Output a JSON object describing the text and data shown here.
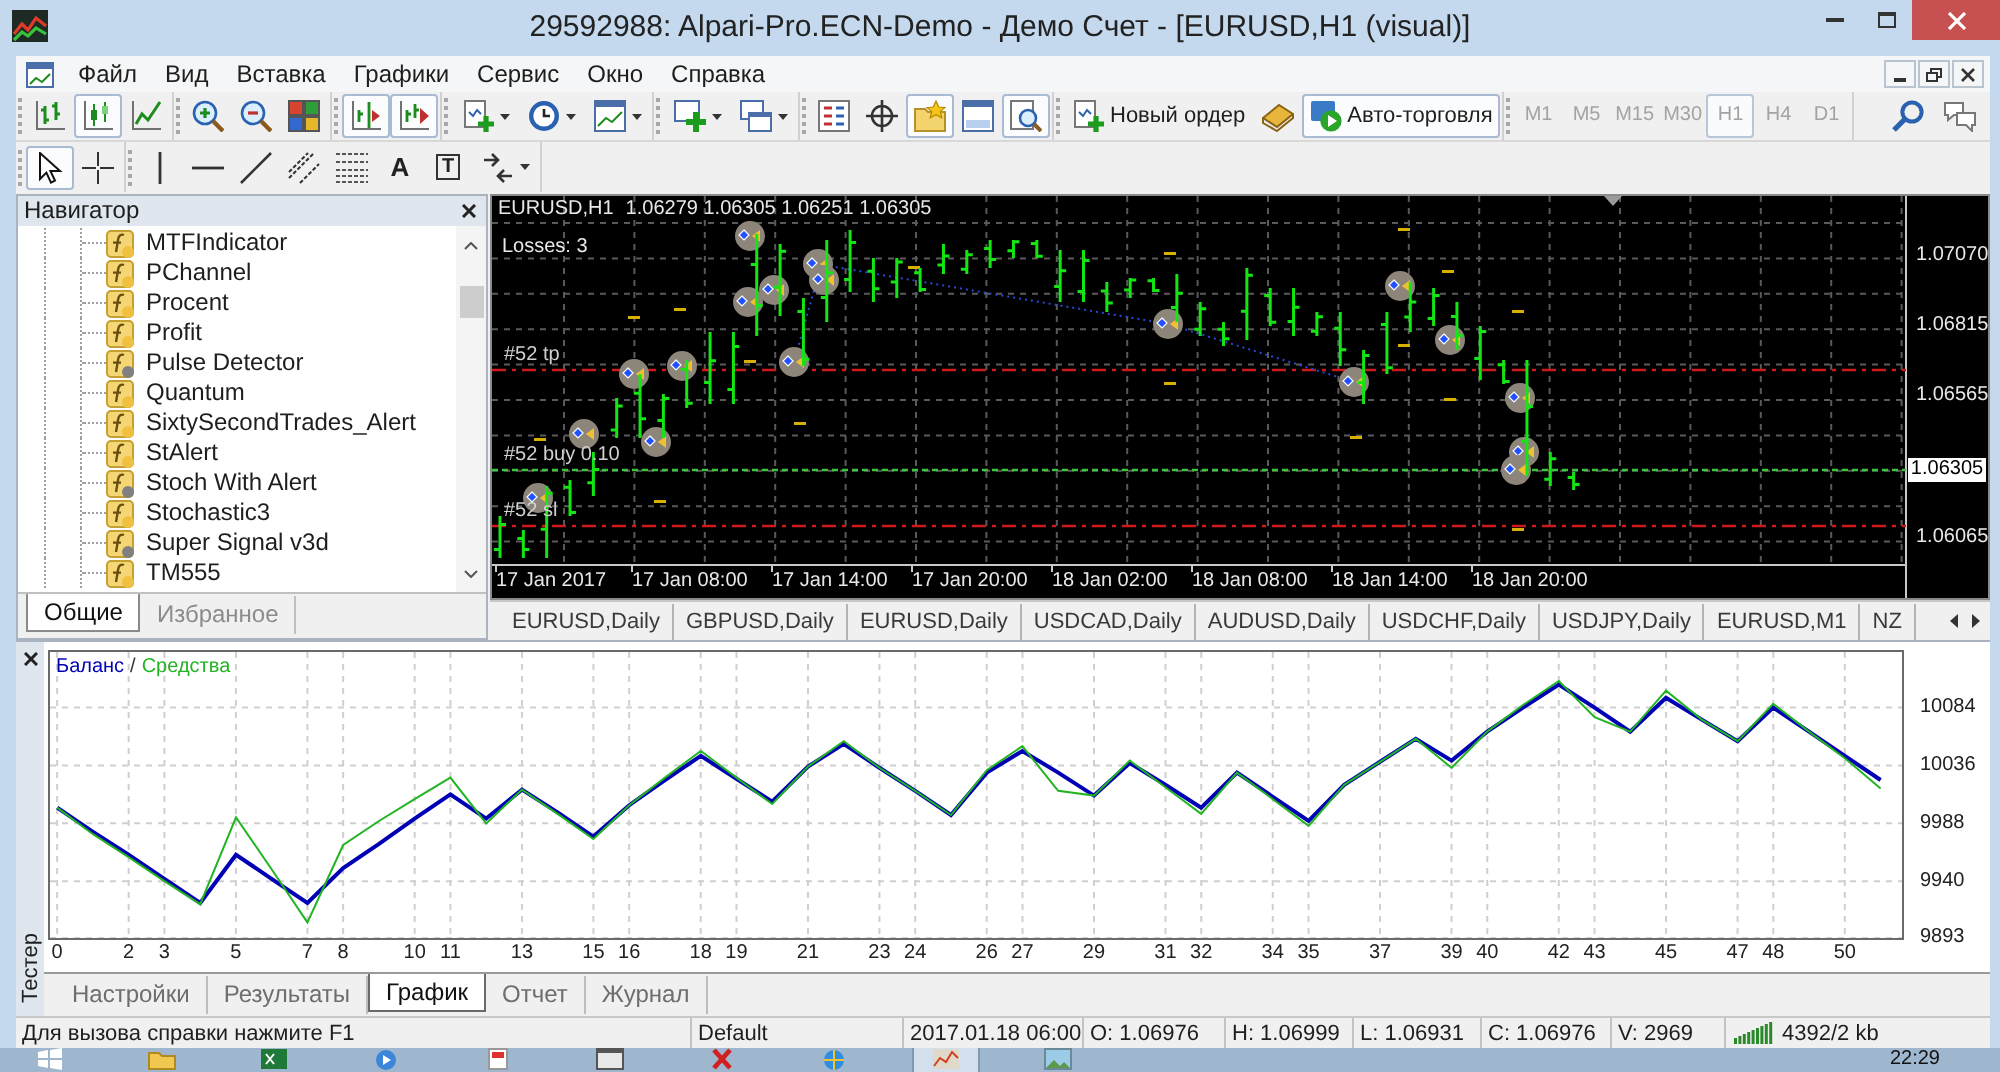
{
  "window": {
    "title": "29592988: Alpari-Pro.ECN-Demo - Демо Счет - [EURUSD,H1 (visual)]"
  },
  "menu": [
    "Файл",
    "Вид",
    "Вставка",
    "Графики",
    "Сервис",
    "Окно",
    "Справка"
  ],
  "toolbar": {
    "groups": [
      [
        {
          "kind": "bars",
          "pressed": false
        },
        {
          "kind": "candles",
          "pressed": true
        },
        {
          "kind": "line",
          "pressed": false
        }
      ],
      [
        {
          "kind": "zoom-in",
          "pressed": false
        },
        {
          "kind": "zoom-out",
          "pressed": false
        },
        {
          "kind": "tile",
          "pressed": false
        }
      ],
      [
        {
          "kind": "shift",
          "pressed": true
        },
        {
          "kind": "autoscroll",
          "pressed": true
        }
      ],
      [
        {
          "kind": "indicators",
          "menu": true
        },
        {
          "kind": "periods",
          "menu": true
        },
        {
          "kind": "templates",
          "menu": true
        }
      ],
      [
        {
          "kind": "new-chart",
          "menu": true
        },
        {
          "kind": "profiles",
          "menu": true
        }
      ],
      [
        {
          "kind": "market-watch",
          "pressed": false
        },
        {
          "kind": "data-window",
          "pressed": false
        },
        {
          "kind": "navigator",
          "pressed": true
        },
        {
          "kind": "terminal",
          "pressed": false
        },
        {
          "kind": "tester",
          "pressed": true
        }
      ],
      [
        {
          "kind": "new-order",
          "label": "Новый ордер",
          "pressed": false
        },
        {
          "kind": "editor",
          "pressed": false
        },
        {
          "kind": "auto-trading",
          "label": "Авто-торговля",
          "pressed": true
        }
      ]
    ],
    "periods": [
      {
        "label": "M1",
        "selected": false,
        "disabled": true
      },
      {
        "label": "M5",
        "selected": false,
        "disabled": true
      },
      {
        "label": "M15",
        "selected": false,
        "disabled": true
      },
      {
        "label": "M30",
        "selected": false,
        "disabled": true
      },
      {
        "label": "H1",
        "selected": true,
        "disabled": true
      },
      {
        "label": "H4",
        "selected": false,
        "disabled": true
      },
      {
        "label": "D1",
        "selected": false,
        "disabled": true
      }
    ],
    "extras": [
      {
        "kind": "search"
      },
      {
        "kind": "chat"
      }
    ]
  },
  "drawing_tools": {
    "groups": [
      [
        {
          "kind": "cursor",
          "pressed": true
        },
        {
          "kind": "crosshair",
          "pressed": false
        }
      ],
      [
        {
          "kind": "vline",
          "pressed": false
        },
        {
          "kind": "hline",
          "pressed": false
        },
        {
          "kind": "trendline",
          "pressed": false
        },
        {
          "kind": "channel",
          "pressed": false
        },
        {
          "kind": "fibo",
          "pressed": false
        },
        {
          "kind": "text",
          "label": "A",
          "pressed": false
        },
        {
          "kind": "text-label",
          "label": "T",
          "pressed": false
        },
        {
          "kind": "arrows",
          "menu": true
        }
      ]
    ]
  },
  "navigator": {
    "title": "Навигатор",
    "items": [
      {
        "label": "MTFIndicator",
        "color": "#f0c040"
      },
      {
        "label": "PChannel",
        "color": "#f0c040"
      },
      {
        "label": "Procent",
        "color": "#f0c040"
      },
      {
        "label": "Profit",
        "color": "#f0c040"
      },
      {
        "label": "Pulse Detector",
        "color": "#808080"
      },
      {
        "label": "Quantum",
        "color": "#f0c040"
      },
      {
        "label": "SixtySecondTrades_Alert",
        "color": "#f0c040"
      },
      {
        "label": "StAlert",
        "color": "#f0c040"
      },
      {
        "label": "Stoch With Alert",
        "color": "#808080"
      },
      {
        "label": "Stochastic3",
        "color": "#f0c040"
      },
      {
        "label": "Super Signal v3d",
        "color": "#808080"
      },
      {
        "label": "TM555",
        "color": "#f0c040"
      }
    ],
    "tabs": [
      {
        "label": "Общие",
        "selected": true
      },
      {
        "label": "Избранное",
        "selected": false
      }
    ]
  },
  "chart": {
    "symbol": "EURUSD,H1",
    "ohlc": "1.06279 1.06305 1.06251 1.06305",
    "info": "Losses: 3",
    "orders": [
      {
        "kind": "tp",
        "label": "#52 tp"
      },
      {
        "kind": "entry",
        "label": "#52 buy 0.10"
      },
      {
        "kind": "sl",
        "label": "#52 sl"
      }
    ],
    "price_ticks": [
      "1.07070",
      "1.06815",
      "1.06565",
      "1.06065"
    ],
    "current_price": "1.06305",
    "time_ticks": [
      "17 Jan 2017",
      "17 Jan 08:00",
      "17 Jan 14:00",
      "17 Jan 20:00",
      "18 Jan 02:00",
      "18 Jan 08:00",
      "18 Jan 14:00",
      "18 Jan 20:00"
    ]
  },
  "chart_tabs": [
    {
      "label": "EURUSD,Daily",
      "selected": false
    },
    {
      "label": "GBPUSD,Daily",
      "selected": false
    },
    {
      "label": "EURUSD,Daily",
      "selected": false
    },
    {
      "label": "USDCAD,Daily",
      "selected": false
    },
    {
      "label": "AUDUSD,Daily",
      "selected": false
    },
    {
      "label": "USDCHF,Daily",
      "selected": false
    },
    {
      "label": "USDJPY,Daily",
      "selected": false
    },
    {
      "label": "EURUSD,M1",
      "selected": false
    },
    {
      "label": "NZ",
      "selected": false
    }
  ],
  "tester": {
    "title": "Тестер",
    "separator": "/",
    "chart_data": {
      "type": "line",
      "grid": true,
      "x": [
        0,
        1,
        2,
        3,
        4,
        5,
        6,
        7,
        8,
        9,
        10,
        11,
        12,
        13,
        14,
        15,
        16,
        17,
        18,
        19,
        20,
        21,
        22,
        23,
        24,
        25,
        26,
        27,
        28,
        29,
        30,
        31,
        32,
        33,
        34,
        35,
        36,
        37,
        38,
        39,
        40,
        41,
        42,
        43,
        44,
        45,
        46,
        47,
        48,
        49,
        50,
        51
      ],
      "series": [
        {
          "name": "Баланс",
          "color": "#0000b4",
          "values": [
            10001,
            9981,
            9962,
            9942,
            9922,
            9962,
            9942,
            9922,
            9951,
            9971,
            9992,
            10012,
            9992,
            10016,
            9997,
            9977,
            10003,
            10024,
            10044,
            10025,
            10006,
            10035,
            10054,
            10034,
            10015,
            9995,
            10030,
            10048,
            10030,
            10011,
            10038,
            10020,
            10001,
            10030,
            10010,
            9990,
            10020,
            10039,
            10058,
            10040,
            10064,
            10084,
            10103,
            10084,
            10064,
            10092,
            10074,
            10056,
            10084,
            10064,
            10044,
            10024
          ]
        },
        {
          "name": "Средства",
          "color": "#22b422",
          "values": [
            10001,
            9979,
            9960,
            9940,
            9921,
            9993,
            9950,
            9906,
            9970,
            9990,
            10008,
            10026,
            9988,
            10016,
            9996,
            9975,
            10003,
            10026,
            10048,
            10026,
            10004,
            10035,
            10056,
            10034,
            10015,
            9995,
            10032,
            10052,
            10015,
            10011,
            10040,
            10018,
            9996,
            10030,
            10008,
            9986,
            10020,
            10039,
            10058,
            10034,
            10064,
            10086,
            10106,
            10076,
            10064,
            10098,
            10074,
            10056,
            10087,
            10064,
            10042,
            10017
          ]
        }
      ],
      "xlim": [
        -0.2,
        51.6
      ],
      "ylim": [
        9893,
        10130
      ],
      "xticks": [
        0,
        2,
        3,
        5,
        7,
        8,
        10,
        11,
        13,
        15,
        16,
        18,
        19,
        21,
        23,
        24,
        26,
        27,
        29,
        31,
        32,
        34,
        35,
        37,
        39,
        40,
        42,
        43,
        45,
        47,
        48,
        50
      ],
      "yticks": [
        9893,
        9940,
        9988,
        10036,
        10084
      ]
    },
    "tabs": [
      {
        "label": "Настройки",
        "selected": false
      },
      {
        "label": "Результаты",
        "selected": false
      },
      {
        "label": "График",
        "selected": true
      },
      {
        "label": "Отчет",
        "selected": false
      },
      {
        "label": "Журнал",
        "selected": false
      }
    ]
  },
  "status_bar": {
    "cells": [
      "Для вызова справки нажмите F1",
      "Default",
      "2017.01.18 06:00",
      "O: 1.06976",
      "H: 1.06999",
      "L: 1.06931",
      "C: 1.06976",
      "V: 2969"
    ],
    "traffic": "4392/2 kb"
  },
  "taskbar": {
    "apps": [
      {
        "kind": "start",
        "selected": false
      },
      {
        "kind": "folder",
        "selected": false
      },
      {
        "kind": "spreadsheet",
        "selected": false
      },
      {
        "kind": "media",
        "selected": false
      },
      {
        "kind": "document",
        "selected": false
      },
      {
        "kind": "window",
        "selected": false
      },
      {
        "kind": "cross",
        "selected": false
      },
      {
        "kind": "globe",
        "selected": false
      },
      {
        "kind": "chart",
        "selected": true
      },
      {
        "kind": "picture",
        "selected": false
      }
    ],
    "clock": "22:29"
  }
}
